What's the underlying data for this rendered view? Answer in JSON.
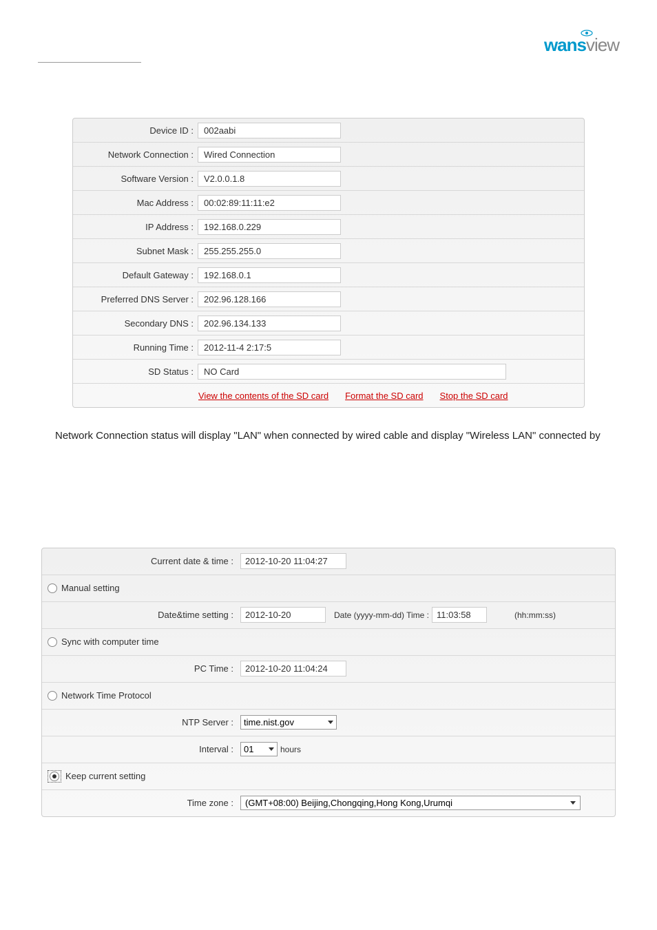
{
  "logo": {
    "part1": "wans",
    "part2": "view"
  },
  "info": {
    "device_id": {
      "label": "Device ID :",
      "value": "002aabi"
    },
    "network_connection": {
      "label": "Network Connection :",
      "value": "Wired Connection"
    },
    "software_version": {
      "label": "Software Version :",
      "value": "V2.0.0.1.8"
    },
    "mac_address": {
      "label": "Mac Address :",
      "value": "00:02:89:11:11:e2"
    },
    "ip_address": {
      "label": "IP Address :",
      "value": "192.168.0.229"
    },
    "subnet_mask": {
      "label": "Subnet Mask :",
      "value": "255.255.255.0"
    },
    "default_gateway": {
      "label": "Default Gateway :",
      "value": "192.168.0.1"
    },
    "preferred_dns": {
      "label": "Preferred DNS Server :",
      "value": "202.96.128.166"
    },
    "secondary_dns": {
      "label": "Secondary DNS :",
      "value": "202.96.134.133"
    },
    "running_time": {
      "label": "Running Time :",
      "value": "2012-11-4 2:17:5"
    },
    "sd_status": {
      "label": "SD Status :",
      "value": "NO Card"
    },
    "sd_links": {
      "view": "View the contents of the SD card",
      "format": "Format the SD card",
      "stop": "Stop the SD card"
    }
  },
  "paragraph": "Network Connection status will display \"LAN\" when connected by wired cable and display \"Wireless LAN\" connected by",
  "time": {
    "current": {
      "label": "Current date & time :",
      "value": "2012-10-20 11:04:27"
    },
    "manual": {
      "label": "Manual setting",
      "date_label": "Date&time setting :",
      "date_value": "2012-10-20",
      "date_hint": "Date (yyyy-mm-dd) Time :",
      "time_value": "11:03:58",
      "time_hint": "(hh:mm:ss)"
    },
    "sync": {
      "label": "Sync with computer time",
      "pc_label": "PC Time :",
      "pc_value": "2012-10-20 11:04:24"
    },
    "ntp": {
      "label": "Network Time Protocol",
      "server_label": "NTP Server :",
      "server_value": "time.nist.gov",
      "interval_label": "Interval :",
      "interval_value": "01",
      "interval_unit": "hours"
    },
    "keep": {
      "label": "Keep current setting"
    },
    "timezone": {
      "label": "Time zone :",
      "value": "(GMT+08:00) Beijing,Chongqing,Hong Kong,Urumqi"
    }
  }
}
